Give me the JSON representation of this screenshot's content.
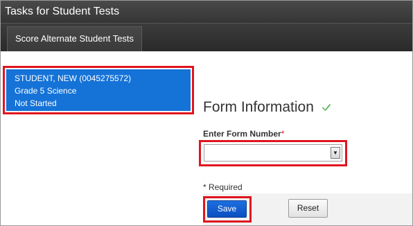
{
  "window": {
    "title": "Tasks for Student Tests"
  },
  "tabs": [
    {
      "label": "Score Alternate Student Tests"
    }
  ],
  "student": {
    "name": "STUDENT, NEW (0045275572)",
    "test": "Grade 5 Science",
    "status": "Not Started"
  },
  "form": {
    "title": "Form Information",
    "title_icon": "checkmark-icon",
    "field_label": "Enter Form Number",
    "required_marker": "*",
    "form_number_value": "",
    "required_note": "* Required"
  },
  "buttons": {
    "save": "Save",
    "reset": "Reset"
  },
  "colors": {
    "highlight": "#e0141e",
    "student_card": "#1573d8",
    "save_button": "#0b4fc0",
    "check": "#5cb85c"
  }
}
